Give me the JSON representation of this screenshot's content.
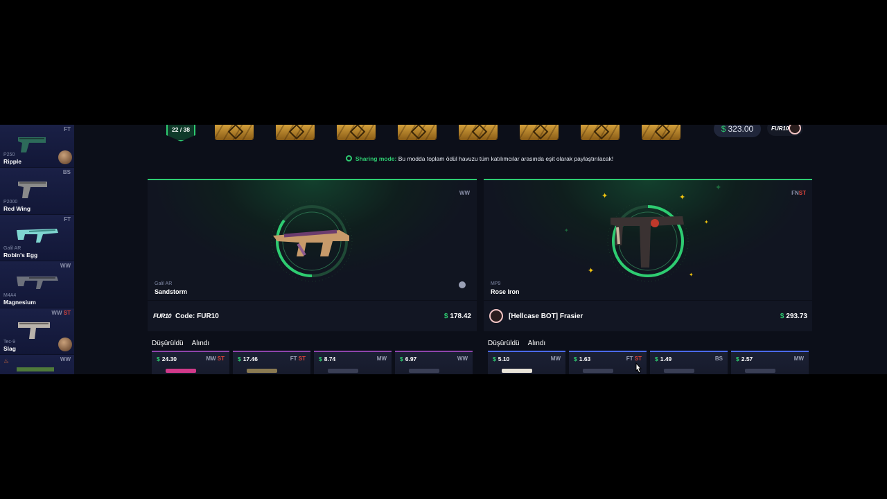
{
  "sidebar": {
    "items": [
      {
        "condition": "FT",
        "st": "",
        "model": "P250",
        "skin": "Ripple",
        "avatar": true,
        "fire": false
      },
      {
        "condition": "BS",
        "st": "",
        "model": "P2000",
        "skin": "Red Wing",
        "avatar": false,
        "fire": false
      },
      {
        "condition": "FT",
        "st": "",
        "model": "Galil AR",
        "skin": "Robin's Egg",
        "avatar": false,
        "fire": false
      },
      {
        "condition": "WW",
        "st": "",
        "model": "M4A4",
        "skin": "Magnesium",
        "avatar": false,
        "fire": false
      },
      {
        "condition": "WW",
        "st": "ST",
        "model": "Tec-9",
        "skin": "Slag",
        "avatar": true,
        "fire": false
      },
      {
        "condition": "WW",
        "st": "",
        "model": "",
        "skin": "",
        "avatar": false,
        "fire": true
      }
    ]
  },
  "header": {
    "round": "22 / 38",
    "balance": "323.00",
    "currency": "$",
    "user_logo": "FUR10"
  },
  "sharing": {
    "label": "Sharing mode:",
    "text": "Bu modda toplam ödül havuzu tüm katılımcılar arasında eşit olarak paylaştırılacak!"
  },
  "panels": [
    {
      "condition": "WW",
      "st": "",
      "model": "Galil AR",
      "skin": "Sandstorm",
      "owner_logo": "FUR10",
      "owner_name": "Code: FUR10",
      "price": "178.42",
      "tabs": [
        "Düşürüldü",
        "Alındı"
      ],
      "drops": [
        {
          "price": "24.30",
          "condition": "MW",
          "st": "ST",
          "rarity": "purple"
        },
        {
          "price": "17.46",
          "condition": "FT",
          "st": "ST",
          "rarity": "purple"
        },
        {
          "price": "8.74",
          "condition": "MW",
          "st": "",
          "rarity": "purple"
        },
        {
          "price": "6.97",
          "condition": "WW",
          "st": "",
          "rarity": "purple"
        }
      ]
    },
    {
      "condition": "FN",
      "st": "ST",
      "model": "MP9",
      "skin": "Rose Iron",
      "owner_logo": "",
      "owner_name": "[Hellcase BOT] Frasier",
      "price": "293.73",
      "tabs": [
        "Düşürüldü",
        "Alındı"
      ],
      "drops": [
        {
          "price": "5.10",
          "condition": "MW",
          "st": "",
          "rarity": "blue"
        },
        {
          "price": "1.63",
          "condition": "FT",
          "st": "ST",
          "rarity": "blue"
        },
        {
          "price": "1.49",
          "condition": "BS",
          "st": "",
          "rarity": "blue"
        },
        {
          "price": "2.57",
          "condition": "MW",
          "st": "",
          "rarity": "blue"
        }
      ]
    }
  ],
  "colors": {
    "accent": "#2ecc71",
    "stattrak": "#e2453b",
    "background": "#0c0f19",
    "sidebar": "#141a36",
    "gold_case": "#d8a53e"
  },
  "icons": [
    "shield-round-icon",
    "case-icon",
    "eye-icon",
    "star-icon",
    "cursor-icon",
    "check-circle-icon"
  ]
}
